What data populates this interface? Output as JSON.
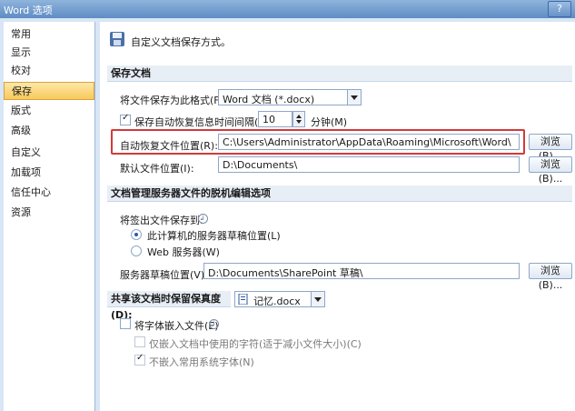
{
  "window": {
    "title": "Word 选项",
    "help": "?"
  },
  "sidebar": {
    "items": [
      {
        "label": "常用"
      },
      {
        "label": "显示"
      },
      {
        "label": "校对"
      },
      {
        "label": "保存",
        "active": true
      },
      {
        "label": "版式"
      },
      {
        "label": "高级"
      },
      {
        "label": "自定义"
      },
      {
        "label": "加载项"
      },
      {
        "label": "信任中心"
      },
      {
        "label": "资源"
      }
    ]
  },
  "main": {
    "header": "自定义文档保存方式。",
    "save_docs": {
      "title": "保存文档",
      "format_label": "将文件保存为此格式(F):",
      "format_value": "Word 文档 (*.docx)",
      "autosave_label": "保存自动恢复信息时间间隔(A)",
      "autosave_value": "10",
      "autosave_unit": "分钟(M)",
      "autorecover_label": "自动恢复文件位置(R):",
      "autorecover_value": "C:\\Users\\Administrator\\AppData\\Roaming\\Microsoft\\Word\\",
      "default_label": "默认文件位置(I):",
      "default_value": "D:\\Documents\\",
      "browse": "浏览(B)..."
    },
    "offline": {
      "title": "文档管理服务器文件的脱机编辑选项",
      "checkout_label": "将签出文件保存到:",
      "radio1": "此计算机的服务器草稿位置(L)",
      "radio2": "Web 服务器(W)",
      "server_label": "服务器草稿位置(V):",
      "server_value": "D:\\Documents\\SharePoint 草稿\\",
      "browse": "浏览(B)..."
    },
    "fidelity": {
      "title": "共享该文档时保留保真度(D):",
      "doc_value": "记忆.docx",
      "embed_fonts": "将字体嵌入文件(E)",
      "embed_used": "仅嵌入文档中使用的字符(适于减小文件大小)(C)",
      "no_common": "不嵌入常用系统字体(N)"
    }
  },
  "colors": {
    "highlight": "#d23a3a",
    "active_bg": "#f8c95c"
  }
}
